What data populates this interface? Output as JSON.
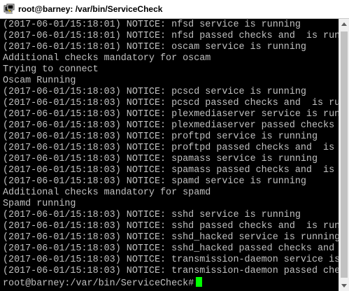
{
  "window": {
    "title": "root@barney: /var/bin/ServiceCheck",
    "icon": "putty-terminal-icon"
  },
  "terminal": {
    "lines": [
      "(2017-06-01/15:18:01) NOTICE: nfsd service is running",
      "(2017-06-01/15:18:01) NOTICE: nfsd passed checks and  is running",
      "(2017-06-01/15:18:01) NOTICE: oscam service is running",
      "Additional checks mandatory for oscam",
      "Trying to connect",
      "Oscam Running",
      "(2017-06-01/15:18:03) NOTICE: pcscd service is running",
      "(2017-06-01/15:18:03) NOTICE: pcscd passed checks and  is running",
      "(2017-06-01/15:18:03) NOTICE: plexmediaserver service is running",
      "(2017-06-01/15:18:03) NOTICE: plexmediaserver passed checks and  is running",
      "(2017-06-01/15:18:03) NOTICE: proftpd service is running",
      "(2017-06-01/15:18:03) NOTICE: proftpd passed checks and  is running",
      "(2017-06-01/15:18:03) NOTICE: spamass service is running",
      "(2017-06-01/15:18:03) NOTICE: spamass passed checks and  is running",
      "(2017-06-01/15:18:03) NOTICE: spamd service is running",
      "Additional checks mandatory for spamd",
      "Spamd running",
      "(2017-06-01/15:18:03) NOTICE: sshd service is running",
      "(2017-06-01/15:18:03) NOTICE: sshd passed checks and  is running",
      "(2017-06-01/15:18:03) NOTICE: sshd_hacked service is running",
      "(2017-06-01/15:18:03) NOTICE: sshd_hacked passed checks and  is running",
      "(2017-06-01/15:18:03) NOTICE: transmission-daemon service is running",
      "(2017-06-01/15:18:03) NOTICE: transmission-daemon passed checks and  is running"
    ],
    "prompt": "root@barney:/var/bin/ServiceCheck#",
    "colors": {
      "background": "#000000",
      "text": "#c0c0c0",
      "cursor": "#00ff00"
    }
  }
}
